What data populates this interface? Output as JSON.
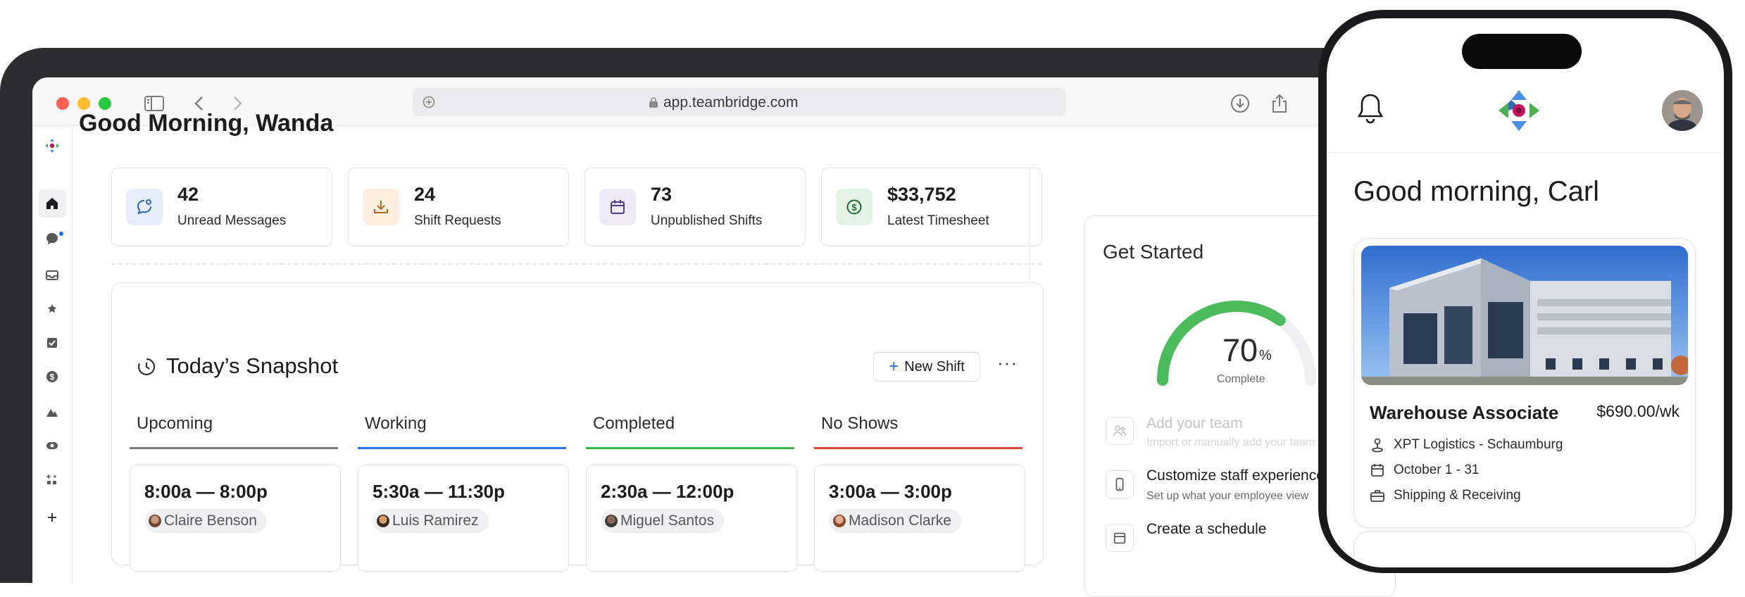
{
  "browser": {
    "url": "app.teambridge.com"
  },
  "dashboard": {
    "greeting": "Good Morning, Wanda",
    "stats": [
      {
        "value": "42",
        "label": "Unread Messages",
        "icon": "message-icon",
        "color": "#e6eefc"
      },
      {
        "value": "24",
        "label": "Shift Requests",
        "icon": "download-icon",
        "color": "#fdeee0"
      },
      {
        "value": "73",
        "label": "Unpublished Shifts",
        "icon": "calendar-icon",
        "color": "#eeeaf8"
      },
      {
        "value": "$33,752",
        "label": "Latest Timesheet",
        "icon": "dollar-icon",
        "color": "#e3f4e6"
      }
    ],
    "snapshot": {
      "title": "Today’s Snapshot",
      "new_shift_label": "New Shift",
      "columns": [
        {
          "label": "Upcoming",
          "color": "#7d7d82",
          "time": "8:00a — 8:00p",
          "person": "Claire Benson"
        },
        {
          "label": "Working",
          "color": "#2d74e0",
          "time": "5:30a — 11:30p",
          "person": "Luis Ramirez"
        },
        {
          "label": "Completed",
          "color": "#3fb54e",
          "time": "2:30a — 12:00p",
          "person": "Miguel Santos"
        },
        {
          "label": "No Shows",
          "color": "#d9463c",
          "time": "3:00a — 3:00p",
          "person": "Madison Clarke"
        }
      ]
    },
    "get_started": {
      "title": "Get Started",
      "progress": 70,
      "progress_value": "70",
      "progress_unit": "%",
      "progress_label": "Complete",
      "tasks": [
        {
          "title": "Add your team",
          "subtitle": "Import or manually add your team",
          "state": "done"
        },
        {
          "title": "Customize staff experience",
          "subtitle": "Set up what your employee view",
          "state": "todo"
        },
        {
          "title": "Create a schedule",
          "subtitle": "",
          "state": "todo"
        }
      ]
    }
  },
  "phone": {
    "greeting": "Good morning, Carl",
    "job": {
      "title": "Warehouse Associate",
      "pay": "$690.00/wk",
      "location": "XPT Logistics - Schaumburg",
      "dates": "October 1 - 31",
      "department": "Shipping & Receiving"
    }
  },
  "colors": {
    "accent": "#1f6fe5",
    "gauge_green": "#4cbb5b",
    "logo_green": "#4caf50",
    "logo_blue": "#4a90e2",
    "logo_magenta": "#c2185b"
  }
}
